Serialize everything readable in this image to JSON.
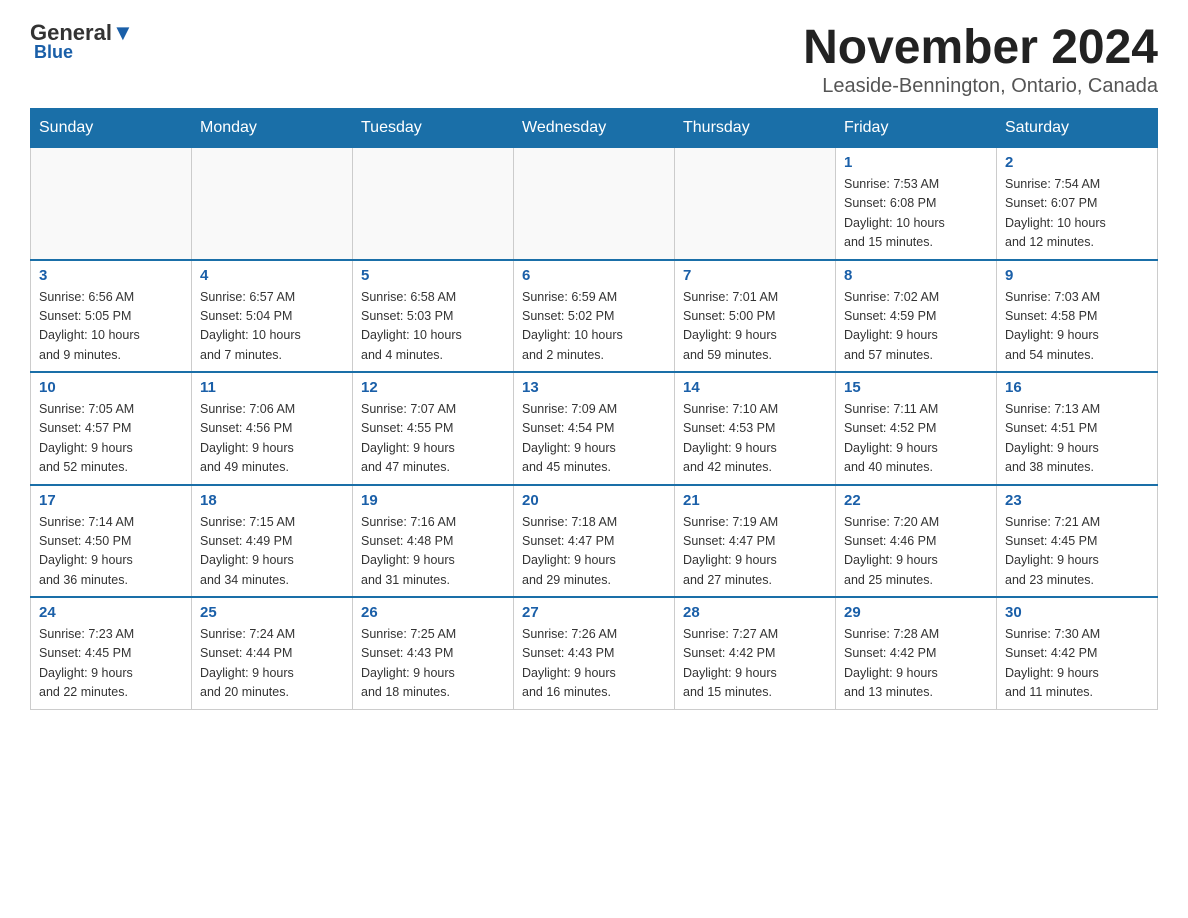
{
  "header": {
    "logo_general": "General",
    "logo_blue": "Blue",
    "month_title": "November 2024",
    "location": "Leaside-Bennington, Ontario, Canada"
  },
  "weekdays": [
    "Sunday",
    "Monday",
    "Tuesday",
    "Wednesday",
    "Thursday",
    "Friday",
    "Saturday"
  ],
  "weeks": [
    [
      {
        "day": "",
        "info": ""
      },
      {
        "day": "",
        "info": ""
      },
      {
        "day": "",
        "info": ""
      },
      {
        "day": "",
        "info": ""
      },
      {
        "day": "",
        "info": ""
      },
      {
        "day": "1",
        "info": "Sunrise: 7:53 AM\nSunset: 6:08 PM\nDaylight: 10 hours\nand 15 minutes."
      },
      {
        "day": "2",
        "info": "Sunrise: 7:54 AM\nSunset: 6:07 PM\nDaylight: 10 hours\nand 12 minutes."
      }
    ],
    [
      {
        "day": "3",
        "info": "Sunrise: 6:56 AM\nSunset: 5:05 PM\nDaylight: 10 hours\nand 9 minutes."
      },
      {
        "day": "4",
        "info": "Sunrise: 6:57 AM\nSunset: 5:04 PM\nDaylight: 10 hours\nand 7 minutes."
      },
      {
        "day": "5",
        "info": "Sunrise: 6:58 AM\nSunset: 5:03 PM\nDaylight: 10 hours\nand 4 minutes."
      },
      {
        "day": "6",
        "info": "Sunrise: 6:59 AM\nSunset: 5:02 PM\nDaylight: 10 hours\nand 2 minutes."
      },
      {
        "day": "7",
        "info": "Sunrise: 7:01 AM\nSunset: 5:00 PM\nDaylight: 9 hours\nand 59 minutes."
      },
      {
        "day": "8",
        "info": "Sunrise: 7:02 AM\nSunset: 4:59 PM\nDaylight: 9 hours\nand 57 minutes."
      },
      {
        "day": "9",
        "info": "Sunrise: 7:03 AM\nSunset: 4:58 PM\nDaylight: 9 hours\nand 54 minutes."
      }
    ],
    [
      {
        "day": "10",
        "info": "Sunrise: 7:05 AM\nSunset: 4:57 PM\nDaylight: 9 hours\nand 52 minutes."
      },
      {
        "day": "11",
        "info": "Sunrise: 7:06 AM\nSunset: 4:56 PM\nDaylight: 9 hours\nand 49 minutes."
      },
      {
        "day": "12",
        "info": "Sunrise: 7:07 AM\nSunset: 4:55 PM\nDaylight: 9 hours\nand 47 minutes."
      },
      {
        "day": "13",
        "info": "Sunrise: 7:09 AM\nSunset: 4:54 PM\nDaylight: 9 hours\nand 45 minutes."
      },
      {
        "day": "14",
        "info": "Sunrise: 7:10 AM\nSunset: 4:53 PM\nDaylight: 9 hours\nand 42 minutes."
      },
      {
        "day": "15",
        "info": "Sunrise: 7:11 AM\nSunset: 4:52 PM\nDaylight: 9 hours\nand 40 minutes."
      },
      {
        "day": "16",
        "info": "Sunrise: 7:13 AM\nSunset: 4:51 PM\nDaylight: 9 hours\nand 38 minutes."
      }
    ],
    [
      {
        "day": "17",
        "info": "Sunrise: 7:14 AM\nSunset: 4:50 PM\nDaylight: 9 hours\nand 36 minutes."
      },
      {
        "day": "18",
        "info": "Sunrise: 7:15 AM\nSunset: 4:49 PM\nDaylight: 9 hours\nand 34 minutes."
      },
      {
        "day": "19",
        "info": "Sunrise: 7:16 AM\nSunset: 4:48 PM\nDaylight: 9 hours\nand 31 minutes."
      },
      {
        "day": "20",
        "info": "Sunrise: 7:18 AM\nSunset: 4:47 PM\nDaylight: 9 hours\nand 29 minutes."
      },
      {
        "day": "21",
        "info": "Sunrise: 7:19 AM\nSunset: 4:47 PM\nDaylight: 9 hours\nand 27 minutes."
      },
      {
        "day": "22",
        "info": "Sunrise: 7:20 AM\nSunset: 4:46 PM\nDaylight: 9 hours\nand 25 minutes."
      },
      {
        "day": "23",
        "info": "Sunrise: 7:21 AM\nSunset: 4:45 PM\nDaylight: 9 hours\nand 23 minutes."
      }
    ],
    [
      {
        "day": "24",
        "info": "Sunrise: 7:23 AM\nSunset: 4:45 PM\nDaylight: 9 hours\nand 22 minutes."
      },
      {
        "day": "25",
        "info": "Sunrise: 7:24 AM\nSunset: 4:44 PM\nDaylight: 9 hours\nand 20 minutes."
      },
      {
        "day": "26",
        "info": "Sunrise: 7:25 AM\nSunset: 4:43 PM\nDaylight: 9 hours\nand 18 minutes."
      },
      {
        "day": "27",
        "info": "Sunrise: 7:26 AM\nSunset: 4:43 PM\nDaylight: 9 hours\nand 16 minutes."
      },
      {
        "day": "28",
        "info": "Sunrise: 7:27 AM\nSunset: 4:42 PM\nDaylight: 9 hours\nand 15 minutes."
      },
      {
        "day": "29",
        "info": "Sunrise: 7:28 AM\nSunset: 4:42 PM\nDaylight: 9 hours\nand 13 minutes."
      },
      {
        "day": "30",
        "info": "Sunrise: 7:30 AM\nSunset: 4:42 PM\nDaylight: 9 hours\nand 11 minutes."
      }
    ]
  ]
}
